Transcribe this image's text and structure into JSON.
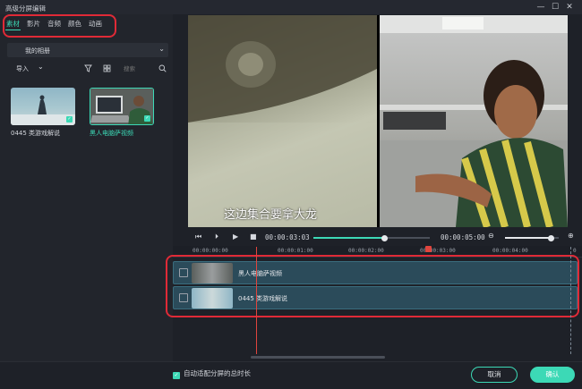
{
  "window": {
    "title": "高级分屏编辑",
    "minimize_icon": "minimize-icon",
    "restore_icon": "restore-icon",
    "close_icon": "close-icon"
  },
  "left_panel": {
    "tabs": [
      {
        "label": "素材",
        "active": true
      },
      {
        "label": "影片",
        "active": false
      },
      {
        "label": "音频",
        "active": false
      },
      {
        "label": "颜色",
        "active": false
      },
      {
        "label": "动画",
        "active": false
      }
    ],
    "album": {
      "label": "我的相册"
    },
    "toolbar": {
      "import_label": "导入",
      "search_placeholder": "搜索"
    },
    "clips": [
      {
        "label": "0445 类游戏解说",
        "selected": true
      },
      {
        "label": "黑人电脑萨视频",
        "selected": true
      }
    ]
  },
  "preview": {
    "subtitle": "这边集合要拿大龙"
  },
  "playback": {
    "current_time": "00:00:03:03",
    "total_time": "00:00:05:00",
    "progress": 0.61,
    "zoom_level": 0.85
  },
  "ruler": {
    "ticks": [
      "00:00:00:00",
      "00:00:01:00",
      "00:00:02:00",
      "00:00:03:00",
      "00:00:04:00",
      "0"
    ]
  },
  "timeline": {
    "tracks": [
      {
        "name": "黑人电脑萨视频"
      },
      {
        "name": "0445 类游戏解说"
      }
    ]
  },
  "footer": {
    "autofit_label": "自动适配分屏的总时长",
    "cancel_label": "取消",
    "ok_label": "确认"
  },
  "colors": {
    "accent": "#3cd9b6",
    "highlight": "#e02a37",
    "playhead": "#e0453e"
  }
}
